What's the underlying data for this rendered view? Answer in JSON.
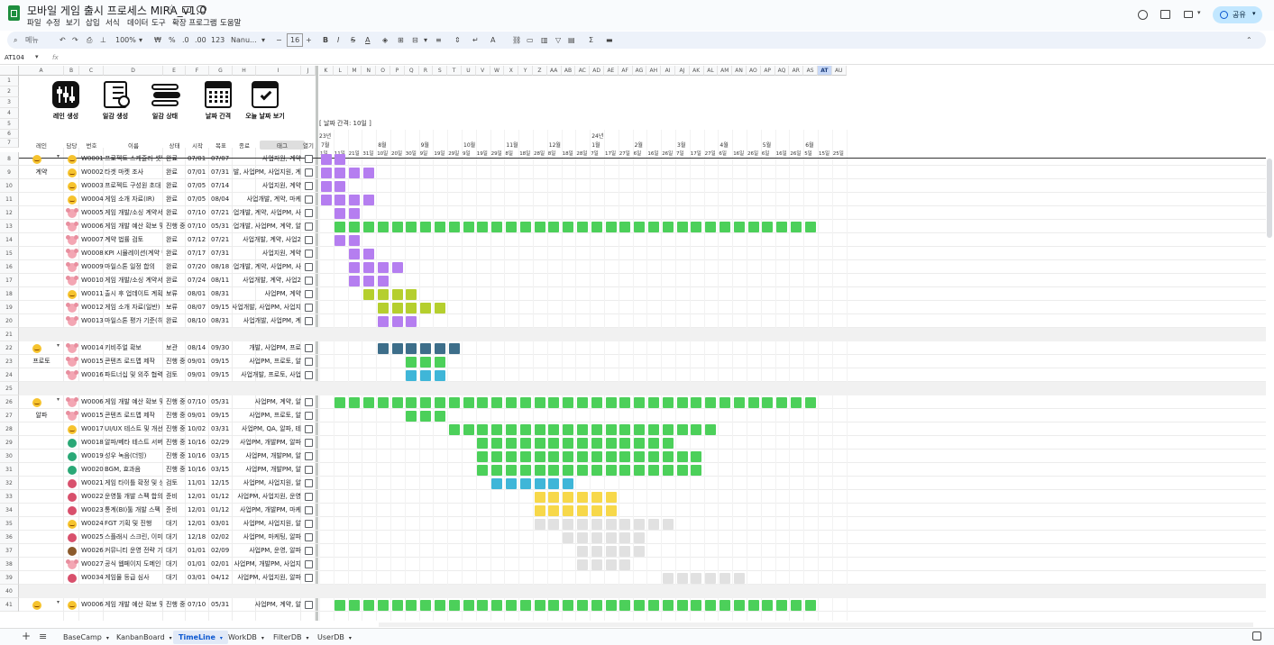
{
  "app": {
    "title": "모바일 게임 출시 프로세스 MIRA_v1.0",
    "menu": [
      "파일",
      "수정",
      "보기",
      "삽입",
      "서식",
      "데이터",
      "도구",
      "확장 프로그램",
      "도움말"
    ],
    "share_label": "공유"
  },
  "toolbar": {
    "menu_search": "메뉴",
    "zoom": "100%",
    "currency": "₩",
    "percent": "%",
    "dec_decrease": ".0",
    "dec_increase": ".00",
    "number_format": "123",
    "font": "Nanu...",
    "font_size": "16",
    "minus": "−",
    "plus": "+"
  },
  "formula": {
    "cell_ref": "AT104",
    "fx": "fx",
    "value": ""
  },
  "columns": {
    "left": [
      "A",
      "B",
      "C",
      "D",
      "E",
      "F",
      "G",
      "H",
      "I",
      "J"
    ],
    "right": [
      "K",
      "L",
      "M",
      "N",
      "O",
      "P",
      "Q",
      "R",
      "S",
      "T",
      "U",
      "V",
      "W",
      "X",
      "Y",
      "Z",
      "AA",
      "AB",
      "AC",
      "AD",
      "AE",
      "AF",
      "AG",
      "AH",
      "AI",
      "AJ",
      "AK",
      "AL",
      "AM",
      "AN",
      "AO",
      "AP",
      "AQ",
      "AR",
      "AS",
      "AT",
      "AU"
    ]
  },
  "action_buttons": [
    {
      "label": "레인 생성",
      "icon": "sliders-icon"
    },
    {
      "label": "일감 생성",
      "icon": "checklist-icon"
    },
    {
      "label": "일감 상태",
      "icon": "toggles-icon"
    },
    {
      "label": "날짜 간격",
      "icon": "calendar-icon"
    },
    {
      "label": "오늘 날짜 보기",
      "icon": "calendar-check-icon"
    }
  ],
  "date_interval_label": "[ 날짜 간격: 10일 ]",
  "table_headers": {
    "lane": "레인",
    "owner": "담당",
    "id": "번호",
    "name": "이름",
    "status": "상태",
    "start": "시작",
    "end": "목표",
    "done": "종료",
    "tags": "태그",
    "open": "열기"
  },
  "timeline": {
    "year_23": "23년",
    "year_24": "24년",
    "months": [
      {
        "label": "7월",
        "col": 0
      },
      {
        "label": "8월",
        "col": 4
      },
      {
        "label": "9월",
        "col": 7
      },
      {
        "label": "10월",
        "col": 10
      },
      {
        "label": "11월",
        "col": 13
      },
      {
        "label": "12월",
        "col": 16
      },
      {
        "label": "1월",
        "col": 19
      },
      {
        "label": "2월",
        "col": 22
      },
      {
        "label": "3월",
        "col": 25
      },
      {
        "label": "4월",
        "col": 28
      },
      {
        "label": "5월",
        "col": 31
      },
      {
        "label": "6월",
        "col": 34
      }
    ],
    "days": [
      "1일",
      "11일",
      "21일",
      "31일",
      "10일",
      "20일",
      "30일",
      "9일",
      "19일",
      "29일",
      "9일",
      "19일",
      "29일",
      "8일",
      "18일",
      "28일",
      "8일",
      "18일",
      "28일",
      "7일",
      "17일",
      "27일",
      "6일",
      "16일",
      "26일",
      "7일",
      "17일",
      "27일",
      "6일",
      "16일",
      "26일",
      "6일",
      "16일",
      "26일",
      "5일",
      "15일",
      "25일"
    ]
  },
  "colors": {
    "purple": "#b57ef0",
    "green": "#4cd05a",
    "olive": "#b5cf2e",
    "teal": "#3d6e8a",
    "cyan": "#3fb6d8",
    "yellow": "#f7d84a",
    "grey": "#e1e1e1",
    "sep": "#f1f1f1",
    "selected": "#c7d8f7"
  },
  "rows": [
    {
      "rownum": "1",
      "type": "blank"
    },
    {
      "rownum": "2",
      "type": "blank"
    },
    {
      "rownum": "3",
      "type": "blank"
    },
    {
      "rownum": "4",
      "type": "blank"
    },
    {
      "rownum": "5",
      "type": "blank"
    },
    {
      "rownum": "6",
      "type": "blank"
    },
    {
      "rownum": "7",
      "type": "blank"
    },
    {
      "rownum": "8",
      "type": "task",
      "lane": "",
      "lane_icon": true,
      "owner": "face",
      "id": "W0001",
      "name": "프로젝트 스케줄러 셋팅",
      "status": "완료",
      "start": "07/01",
      "end": "07/07",
      "tags": "사업지원, 계약",
      "color": "purple",
      "bars": [
        0,
        1
      ]
    },
    {
      "rownum": "9",
      "type": "task",
      "lane": "계약",
      "owner": "face",
      "id": "W0002",
      "name": "타겟 마켓 조사",
      "status": "완료",
      "start": "07/01",
      "end": "07/31",
      "tags": "업개발, 사업PM, 사업지원, 계",
      "color": "purple",
      "bars": [
        0,
        1,
        2,
        3
      ]
    },
    {
      "rownum": "10",
      "type": "task",
      "owner": "face",
      "id": "W0003",
      "name": "프로젝트 구성원 초대",
      "status": "완료",
      "start": "07/05",
      "end": "07/14",
      "tags": "사업지원, 계약",
      "color": "purple",
      "bars": [
        0,
        1
      ]
    },
    {
      "rownum": "11",
      "type": "task",
      "owner": "face",
      "id": "W0004",
      "name": "게임 소개 자료(IR)",
      "status": "완료",
      "start": "07/05",
      "end": "08/04",
      "tags": "사업개발, 계약, 마케",
      "color": "purple",
      "bars": [
        0,
        1,
        2,
        3
      ]
    },
    {
      "rownum": "12",
      "type": "task",
      "owner": "mouse",
      "id": "W0005",
      "name": "게임 개발/소싱 계약서",
      "status": "완료",
      "start": "07/10",
      "end": "07/21",
      "tags": "사업개발, 계약, 사업PM, 사",
      "color": "purple",
      "bars": [
        1,
        2
      ]
    },
    {
      "rownum": "13",
      "type": "task",
      "owner": "mouse",
      "id": "W0006",
      "name": "게임 개발 예산 확보 및",
      "status": "진행 중",
      "start": "07/10",
      "end": "05/31",
      "tags": "사업개발, 사업PM, 계약, 알",
      "color": "green",
      "bars": [
        1,
        2,
        3,
        4,
        5,
        6,
        7,
        8,
        9,
        10,
        11,
        12,
        13,
        14,
        15,
        16,
        17,
        18,
        19,
        20,
        21,
        22,
        23,
        24,
        25,
        26,
        27,
        28,
        29,
        30,
        31,
        32,
        33,
        34
      ]
    },
    {
      "rownum": "14",
      "type": "task",
      "owner": "mouse",
      "id": "W0007",
      "name": "계약 법률 검토",
      "status": "완료",
      "start": "07/12",
      "end": "07/21",
      "tags": "사업개발, 계약, 사업2",
      "color": "purple",
      "bars": [
        1,
        2
      ]
    },
    {
      "rownum": "15",
      "type": "task",
      "owner": "mouse",
      "id": "W0008",
      "name": "KPI 시뮬레이션(계약 단",
      "status": "완료",
      "start": "07/17",
      "end": "07/31",
      "tags": "사업지원, 계약",
      "color": "purple",
      "bars": [
        2,
        3
      ]
    },
    {
      "rownum": "16",
      "type": "task",
      "owner": "mouse",
      "id": "W0009",
      "name": "마일스톤 일정 합의",
      "status": "완료",
      "start": "07/20",
      "end": "08/18",
      "tags": "사업개발, 계약, 사업PM, 사",
      "color": "purple",
      "bars": [
        2,
        3,
        4,
        5
      ]
    },
    {
      "rownum": "17",
      "type": "task",
      "owner": "mouse",
      "id": "W0010",
      "name": "게임 개발/소싱 계약서",
      "status": "완료",
      "start": "07/24",
      "end": "08/11",
      "tags": "사업개발, 계약, 사업2",
      "color": "purple",
      "bars": [
        2,
        3,
        4
      ]
    },
    {
      "rownum": "18",
      "type": "task",
      "owner": "face",
      "id": "W0011",
      "name": "출시 후 업데이트 계획",
      "status": "보류",
      "start": "08/01",
      "end": "08/31",
      "tags": "사업PM, 계약",
      "color": "olive",
      "bars": [
        3,
        4,
        5,
        6
      ]
    },
    {
      "rownum": "19",
      "type": "task",
      "owner": "mouse",
      "id": "W0012",
      "name": "게임 소개 자료(일반)",
      "status": "보류",
      "start": "08/07",
      "end": "09/15",
      "tags": "사업개발, 사업PM, 사업지",
      "color": "olive",
      "bars": [
        4,
        5,
        6,
        7,
        8
      ]
    },
    {
      "rownum": "20",
      "type": "task",
      "owner": "mouse",
      "id": "W0013",
      "name": "마일스톤 평가 기준(히",
      "status": "완료",
      "start": "08/10",
      "end": "08/31",
      "tags": "사업개발, 사업PM, 계",
      "color": "purple",
      "bars": [
        4,
        5,
        6
      ]
    },
    {
      "rownum": "21",
      "type": "sep"
    },
    {
      "rownum": "22",
      "type": "task",
      "lane": "",
      "lane_icon": true,
      "owner": "mouse",
      "id": "W0014",
      "name": "키비주얼 확보",
      "status": "보관",
      "start": "08/14",
      "end": "09/30",
      "tags": "개발, 사업PM, 프로",
      "color": "teal",
      "bars": [
        4,
        5,
        6,
        7,
        8,
        9
      ]
    },
    {
      "rownum": "23",
      "type": "task",
      "lane": "프로토",
      "owner": "mouse",
      "id": "W0015",
      "name": "콘텐츠 로드맵 제작",
      "status": "진행 중",
      "start": "09/01",
      "end": "09/15",
      "tags": "사업PM, 프로토, 알",
      "color": "green",
      "bars": [
        6,
        7,
        8
      ]
    },
    {
      "rownum": "24",
      "type": "task",
      "owner": "mouse",
      "id": "W0016",
      "name": "파트너십 및 외주 협력사",
      "status": "검토",
      "start": "09/01",
      "end": "09/15",
      "tags": "사업개발, 프로토, 사업",
      "color": "cyan",
      "bars": [
        6,
        7,
        8
      ]
    },
    {
      "rownum": "25",
      "type": "sep"
    },
    {
      "rownum": "26",
      "type": "task",
      "lane": "",
      "lane_icon": true,
      "owner": "mouse",
      "id": "W0006",
      "name": "게임 개발 예산 확보 및",
      "status": "진행 중",
      "start": "07/10",
      "end": "05/31",
      "tags": "사업PM, 계약, 알",
      "color": "green",
      "bars": [
        1,
        2,
        3,
        4,
        5,
        6,
        7,
        8,
        9,
        10,
        11,
        12,
        13,
        14,
        15,
        16,
        17,
        18,
        19,
        20,
        21,
        22,
        23,
        24,
        25,
        26,
        27,
        28,
        29,
        30,
        31,
        32,
        33,
        34
      ]
    },
    {
      "rownum": "27",
      "type": "task",
      "lane": "알파",
      "owner": "mouse",
      "id": "W0015",
      "name": "콘텐츠 로드맵 제작",
      "status": "진행 중",
      "start": "09/01",
      "end": "09/15",
      "tags": "사업PM, 프로토, 알",
      "color": "green",
      "bars": [
        6,
        7,
        8
      ]
    },
    {
      "rownum": "28",
      "type": "task",
      "owner": "face",
      "id": "W0017",
      "name": "UI/UX 테스트 및 개선",
      "status": "진행 중",
      "start": "10/02",
      "end": "03/31",
      "tags": "사업PM, QA, 알파, 테",
      "color": "green",
      "bars": [
        9,
        10,
        11,
        12,
        13,
        14,
        15,
        16,
        17,
        18,
        19,
        20,
        21,
        22,
        23,
        24,
        25,
        26,
        27
      ]
    },
    {
      "rownum": "29",
      "type": "task",
      "owner": "dino",
      "id": "W0018",
      "name": "알파/베타 테스트 서버",
      "status": "진행 중",
      "start": "10/16",
      "end": "02/29",
      "tags": "사업PM, 개발PM, 알파",
      "color": "green",
      "bars": [
        11,
        12,
        13,
        14,
        15,
        16,
        17,
        18,
        19,
        20,
        21,
        22,
        23,
        24
      ]
    },
    {
      "rownum": "30",
      "type": "task",
      "owner": "dino",
      "id": "W0019",
      "name": "성우 녹음(더빙)",
      "status": "진행 중",
      "start": "10/16",
      "end": "03/15",
      "tags": "사업PM, 개발PM, 알",
      "color": "green",
      "bars": [
        11,
        12,
        13,
        14,
        15,
        16,
        17,
        18,
        19,
        20,
        21,
        22,
        23,
        24,
        25,
        26
      ]
    },
    {
      "rownum": "31",
      "type": "task",
      "owner": "dino",
      "id": "W0020",
      "name": "BGM, 효과음",
      "status": "진행 중",
      "start": "10/16",
      "end": "03/15",
      "tags": "사업PM, 개발PM, 알",
      "color": "green",
      "bars": [
        11,
        12,
        13,
        14,
        15,
        16,
        17,
        18,
        19,
        20,
        21,
        22,
        23,
        24,
        25,
        26
      ]
    },
    {
      "rownum": "32",
      "type": "task",
      "owner": "hand",
      "id": "W0021",
      "name": "게임 타이틀 확정 및 상",
      "status": "검토",
      "start": "11/01",
      "end": "12/15",
      "tags": "사업PM, 사업지원, 알",
      "color": "cyan",
      "bars": [
        12,
        13,
        14,
        15,
        16,
        17
      ]
    },
    {
      "rownum": "33",
      "type": "task",
      "owner": "hand",
      "id": "W0022",
      "name": "운영툴 개발 스펙 합의",
      "status": "준비",
      "start": "12/01",
      "end": "01/12",
      "tags": "사업PM, 사업지원, 운영",
      "color": "yellow",
      "bars": [
        15,
        16,
        17,
        18,
        19,
        20
      ]
    },
    {
      "rownum": "34",
      "type": "task",
      "owner": "hand",
      "id": "W0023",
      "name": "통계(BI)툴 개발 스펙 합",
      "status": "준비",
      "start": "12/01",
      "end": "01/12",
      "tags": "사업PM, 개발PM, 마케",
      "color": "yellow",
      "bars": [
        15,
        16,
        17,
        18,
        19,
        20
      ]
    },
    {
      "rownum": "35",
      "type": "task",
      "owner": "face",
      "id": "W0024",
      "name": "FGT 기획 및 진행",
      "status": "대기",
      "start": "12/01",
      "end": "03/01",
      "tags": "사업PM, 사업지원, 알",
      "color": "grey",
      "bars": [
        15,
        16,
        17,
        18,
        19,
        20,
        21,
        22,
        23,
        24
      ]
    },
    {
      "rownum": "36",
      "type": "task",
      "owner": "hand",
      "id": "W0025",
      "name": "스플래시 스크린, 이미지",
      "status": "대기",
      "start": "12/18",
      "end": "02/02",
      "tags": "사업PM, 마케팅, 알파",
      "color": "grey",
      "bars": [
        17,
        18,
        19,
        20,
        21,
        22
      ]
    },
    {
      "rownum": "37",
      "type": "task",
      "owner": "man",
      "id": "W0026",
      "name": "커뮤니티 운영 전략 기",
      "status": "대기",
      "start": "01/01",
      "end": "02/09",
      "tags": "사업PM, 운영, 알파",
      "color": "grey",
      "bars": [
        18,
        19,
        20,
        21,
        22
      ]
    },
    {
      "rownum": "38",
      "type": "task",
      "owner": "mouse",
      "id": "W0027",
      "name": "공식 웹페이지 도메인 확",
      "status": "대기",
      "start": "01/01",
      "end": "02/01",
      "tags": "사업PM, 개발PM, 사업지",
      "color": "grey",
      "bars": [
        18,
        19,
        20,
        21
      ]
    },
    {
      "rownum": "39",
      "type": "task",
      "owner": "hand",
      "id": "W0034",
      "name": "게임물 등급 심사",
      "status": "대기",
      "start": "03/01",
      "end": "04/12",
      "tags": "사업PM, 사업지원, 알파",
      "color": "grey",
      "bars": [
        24,
        25,
        26,
        27,
        28,
        29
      ]
    },
    {
      "rownum": "40",
      "type": "sep"
    },
    {
      "rownum": "41",
      "type": "task",
      "lane": "",
      "lane_icon": true,
      "owner": "face",
      "id": "W0006",
      "name": "게임 개발 예산 확보 및",
      "status": "진행 중",
      "start": "07/10",
      "end": "05/31",
      "tags": "사업PM, 계약, 알",
      "color": "green",
      "bars": [
        1,
        2,
        3,
        4,
        5,
        6,
        7,
        8,
        9,
        10,
        11,
        12,
        13,
        14,
        15,
        16,
        17,
        18,
        19,
        20,
        21,
        22,
        23,
        24,
        25,
        26,
        27,
        28,
        29,
        30,
        31,
        32,
        33,
        34
      ]
    }
  ],
  "sheet_tabs": [
    "BaseCamp",
    "KanbanBoard",
    "TimeLine",
    "WorkDB",
    "FilterDB",
    "UserDB"
  ],
  "active_tab": "TimeLine"
}
